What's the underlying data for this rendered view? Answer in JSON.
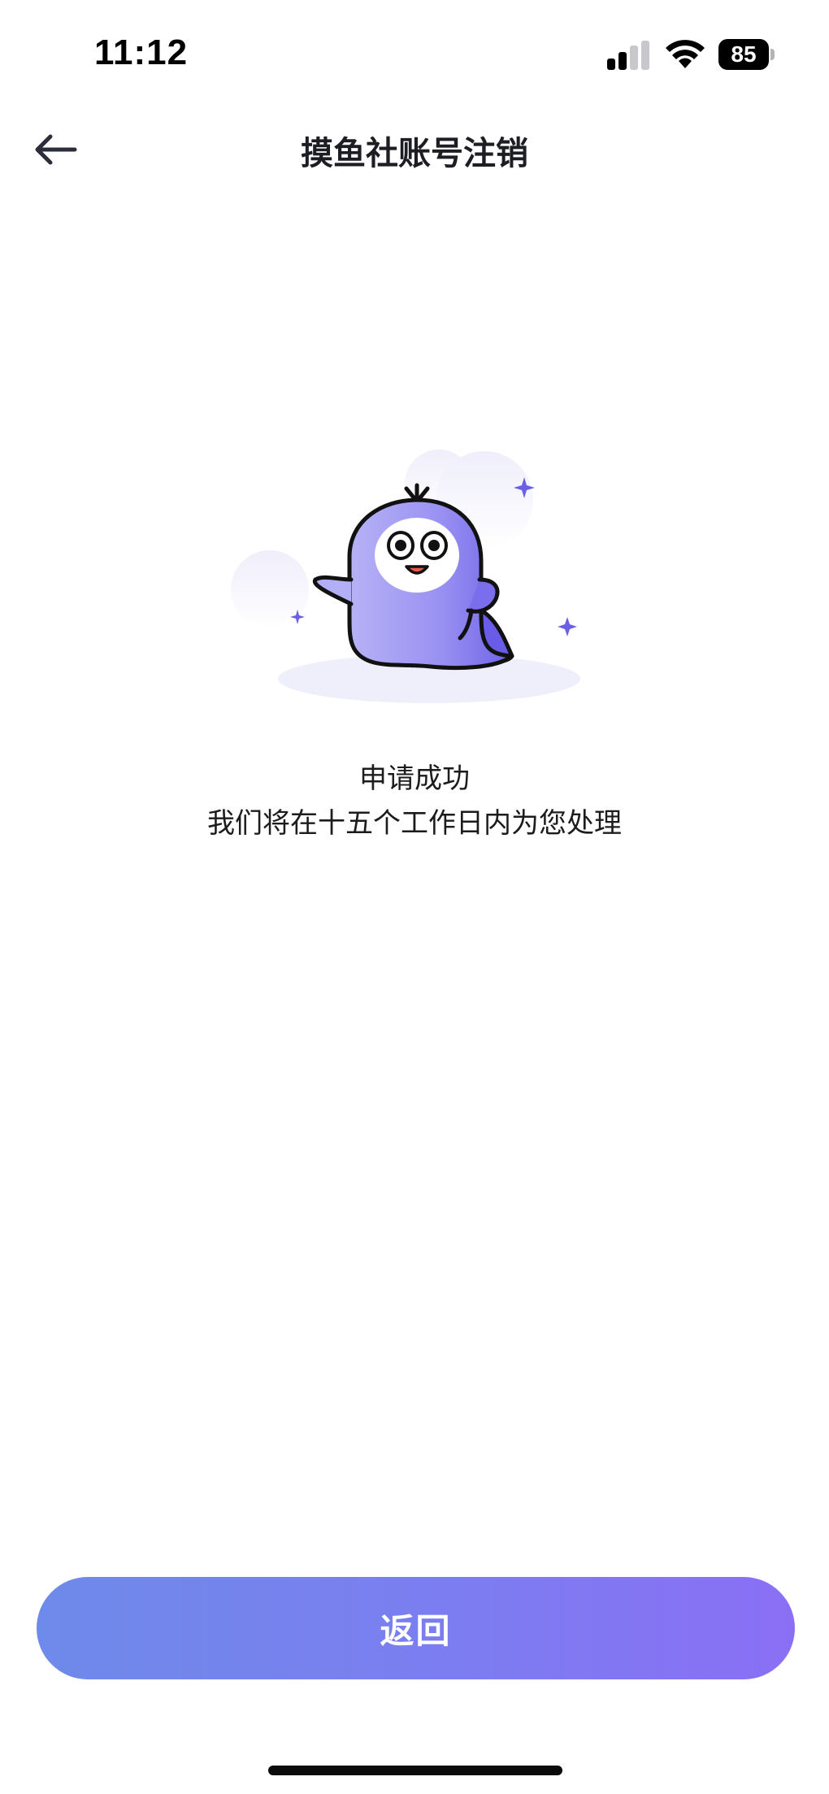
{
  "status_bar": {
    "time": "11:12",
    "battery_level": "85",
    "icons": [
      "signal-icon",
      "wifi-icon",
      "battery-icon"
    ]
  },
  "nav": {
    "back_icon": "arrow-left-icon",
    "title": "摸鱼社账号注销"
  },
  "result": {
    "illustration": "mascot-illustration",
    "title": "申请成功",
    "description": "我们将在十五个工作日内为您处理"
  },
  "actions": {
    "return_label": "返回"
  },
  "colors": {
    "accent_start": "#6e8aea",
    "accent_end": "#8a6ff5",
    "mascot": "#8f86f0"
  }
}
